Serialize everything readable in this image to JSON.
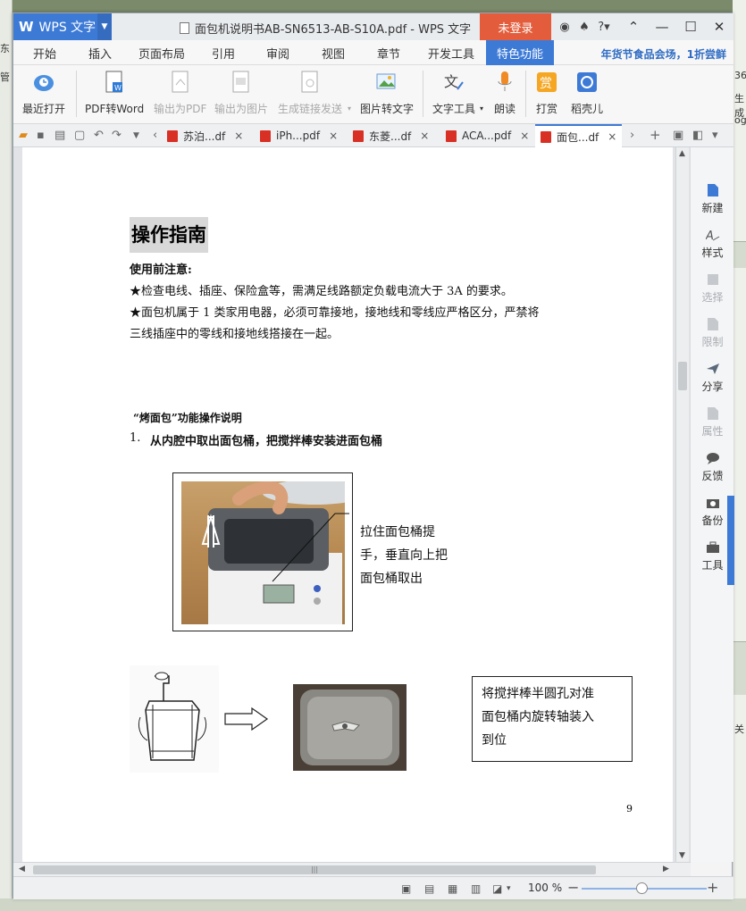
{
  "app": {
    "name": "WPS 文字",
    "document_title": "面包机说明书AB-SN6513-AB-S10A.pdf - WPS 文字",
    "login_label": "未登录"
  },
  "menu": {
    "items": [
      "开始",
      "插入",
      "页面布局",
      "引用",
      "审阅",
      "视图",
      "章节",
      "开发工具",
      "特色功能"
    ],
    "active": "特色功能",
    "promo": "年货节食品会场，1折尝鲜"
  },
  "ribbon": {
    "buttons": [
      {
        "label": "最近打开",
        "icon": "clock-cloud-icon",
        "enabled": true
      },
      {
        "label": "PDF转Word",
        "icon": "pdf-to-word-icon",
        "enabled": true
      },
      {
        "label": "输出为PDF",
        "icon": "export-pdf-icon",
        "enabled": false
      },
      {
        "label": "输出为图片",
        "icon": "export-image-icon",
        "enabled": false
      },
      {
        "label": "生成链接发送",
        "icon": "share-link-icon",
        "enabled": false
      },
      {
        "label": "图片转文字",
        "icon": "image-to-text-icon",
        "enabled": true
      },
      {
        "label": "文字工具",
        "icon": "text-tools-icon",
        "enabled": true
      },
      {
        "label": "朗读",
        "icon": "microphone-icon",
        "enabled": true
      },
      {
        "label": "打赏",
        "icon": "reward-icon",
        "enabled": true
      },
      {
        "label": "稻壳儿",
        "icon": "docer-icon",
        "enabled": true
      }
    ]
  },
  "tabs": [
    {
      "label": "苏泊...df",
      "active": false
    },
    {
      "label": "iPh...pdf",
      "active": false
    },
    {
      "label": "东菱...df",
      "active": false
    },
    {
      "label": "ACA...pdf",
      "active": false
    },
    {
      "label": "面包...df",
      "active": true
    }
  ],
  "side_panel": [
    {
      "label": "新建",
      "icon": "new-doc-icon",
      "enabled": true
    },
    {
      "label": "样式",
      "icon": "style-icon",
      "enabled": true
    },
    {
      "label": "选择",
      "icon": "select-icon",
      "enabled": false
    },
    {
      "label": "限制",
      "icon": "restrict-icon",
      "enabled": false
    },
    {
      "label": "分享",
      "icon": "share-icon",
      "enabled": true
    },
    {
      "label": "属性",
      "icon": "properties-icon",
      "enabled": false
    },
    {
      "label": "反馈",
      "icon": "feedback-icon",
      "enabled": true
    },
    {
      "label": "备份",
      "icon": "backup-icon",
      "enabled": true
    },
    {
      "label": "工具",
      "icon": "toolbox-icon",
      "enabled": true
    }
  ],
  "document": {
    "heading": "操作指南",
    "precaution_title": "使用前注意:",
    "precaution_1": "★检查电线、插座、保险盒等，需满足线路额定负载电流大于 3A 的要求。",
    "precaution_2a": "★面包机属于 1 类家用电器，必须可靠接地，接地线和零线应严格区分，严禁将",
    "precaution_2b": "三线插座中的零线和接地线搭接在一起。",
    "section_title": "“烤面包”功能操作说明",
    "step_1_num": "1.",
    "step_1": "从内腔中取出面包桶，把搅拌棒安装进面包桶",
    "caption_1": [
      "拉住面包桶提",
      "手，垂直向上把",
      "面包桶取出"
    ],
    "caption_2": [
      "将搅拌棒半圆孔对准",
      "面包桶内旋转轴装入",
      "到位"
    ],
    "page_number": "9"
  },
  "status": {
    "zoom": "100 %"
  },
  "colors": {
    "accent": "#3d7ad6",
    "login": "#e35d3c",
    "promo": "#2f6cc4"
  }
}
